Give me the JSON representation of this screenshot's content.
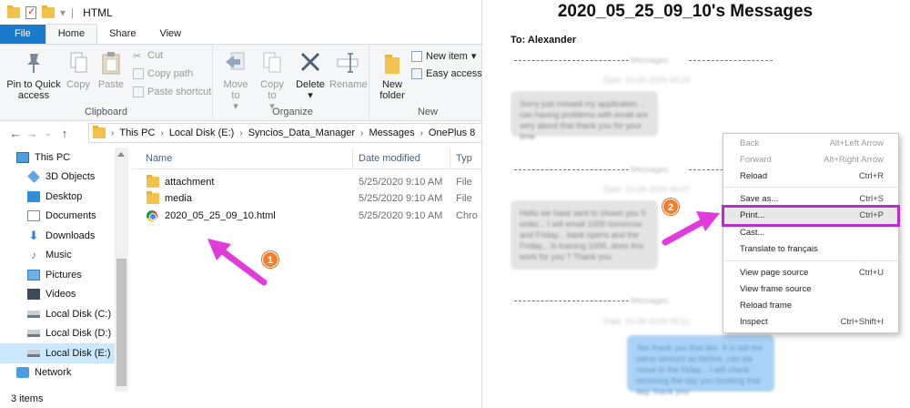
{
  "explorer": {
    "title": "HTML",
    "ribbon_tabs": [
      "File",
      "Home",
      "Share",
      "View"
    ],
    "clipboard": {
      "pin_label": "Pin to Quick access",
      "copy_label": "Copy",
      "paste_label": "Paste",
      "cut_label": "Cut",
      "copy_path_label": "Copy path",
      "paste_shortcut_label": "Paste shortcut",
      "group_label": "Clipboard"
    },
    "organize": {
      "move_label": "Move to",
      "copy_to_label": "Copy to",
      "delete_label": "Delete",
      "rename_label": "Rename",
      "group_label": "Organize"
    },
    "new_group": {
      "new_folder_label": "New folder",
      "new_item_label": "New item",
      "easy_access_label": "Easy access",
      "group_label": "New"
    },
    "breadcrumb": [
      "This PC",
      "Local Disk (E:)",
      "Syncios_Data_Manager",
      "Messages",
      "OnePlus 8"
    ],
    "nav_items": [
      {
        "label": "This PC",
        "icon": "computer-icon"
      },
      {
        "label": "3D Objects",
        "icon": "cube-icon"
      },
      {
        "label": "Desktop",
        "icon": "desktop-icon"
      },
      {
        "label": "Documents",
        "icon": "documents-icon"
      },
      {
        "label": "Downloads",
        "icon": "downloads-icon"
      },
      {
        "label": "Music",
        "icon": "music-icon"
      },
      {
        "label": "Pictures",
        "icon": "pictures-icon"
      },
      {
        "label": "Videos",
        "icon": "videos-icon"
      },
      {
        "label": "Local Disk (C:)",
        "icon": "drive-icon"
      },
      {
        "label": "Local Disk (D:)",
        "icon": "drive-icon"
      },
      {
        "label": "Local Disk (E:)",
        "icon": "drive-icon"
      },
      {
        "label": "Network",
        "icon": "network-icon"
      }
    ],
    "columns": {
      "name": "Name",
      "date": "Date modified",
      "type": "Typ"
    },
    "files": [
      {
        "name": "attachment",
        "date": "5/25/2020 9:10 AM",
        "type": "File",
        "icon": "folder-icon"
      },
      {
        "name": "media",
        "date": "5/25/2020 9:10 AM",
        "type": "File",
        "icon": "folder-icon"
      },
      {
        "name": "2020_05_25_09_10.html",
        "date": "5/25/2020 9:10 AM",
        "type": "Chro",
        "icon": "chrome-icon"
      }
    ],
    "status": "3 items"
  },
  "annotations": {
    "step1": "1",
    "step2": "2"
  },
  "browser": {
    "title": "2020_05_25_09_10's Messages",
    "to_line": "To: Alexander"
  },
  "context_menu": {
    "items": [
      {
        "label": "Back",
        "shortcut": "Alt+Left Arrow",
        "disabled": true
      },
      {
        "label": "Forward",
        "shortcut": "Alt+Right Arrow",
        "disabled": true
      },
      {
        "label": "Reload",
        "shortcut": "Ctrl+R",
        "disabled": false
      },
      {
        "label": "Save as...",
        "shortcut": "Ctrl+S",
        "disabled": false
      },
      {
        "label": "Print...",
        "shortcut": "Ctrl+P",
        "disabled": false
      },
      {
        "label": "Cast...",
        "shortcut": "",
        "disabled": false
      },
      {
        "label": "Translate to français",
        "shortcut": "",
        "disabled": false
      },
      {
        "label": "View page source",
        "shortcut": "Ctrl+U",
        "disabled": false
      },
      {
        "label": "View frame source",
        "shortcut": "",
        "disabled": false
      },
      {
        "label": "Reload frame",
        "shortcut": "",
        "disabled": false
      },
      {
        "label": "Inspect",
        "shortcut": "Ctrl+Shift+I",
        "disabled": false
      }
    ]
  },
  "colors": {
    "accent": "#1979ca",
    "highlight_outline": "#b82ecb",
    "arrow": "#e23bdc",
    "badge": "#f07f2e"
  }
}
